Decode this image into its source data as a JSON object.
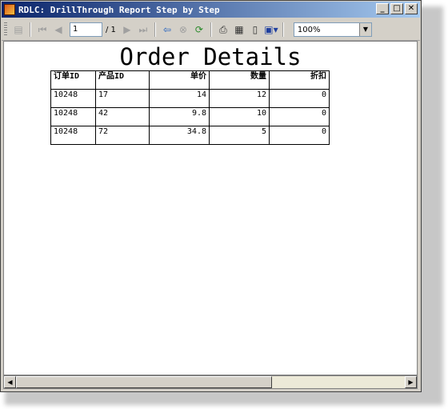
{
  "window": {
    "title": "RDLC: DrillThrough Report Step by Step",
    "buttons": {
      "minimize": "_",
      "maximize": "□",
      "close": "✕"
    }
  },
  "toolbar": {
    "current_page": "1",
    "page_of": "/ 1",
    "zoom": "100%",
    "icons": [
      "document-map-icon",
      "first-page-icon",
      "previous-page-icon",
      "next-page-icon",
      "last-page-icon",
      "back-icon",
      "stop-icon",
      "refresh-icon",
      "print-icon",
      "print-layout-icon",
      "page-setup-icon",
      "export-icon"
    ]
  },
  "report": {
    "title": "Order Details",
    "columns": [
      "订单ID",
      "产品ID",
      "单价",
      "数量",
      "折扣"
    ],
    "rows": [
      [
        "10248",
        "17",
        "14",
        "12",
        "0"
      ],
      [
        "10248",
        "42",
        "9.8",
        "10",
        "0"
      ],
      [
        "10248",
        "72",
        "34.8",
        "5",
        "0"
      ]
    ]
  }
}
